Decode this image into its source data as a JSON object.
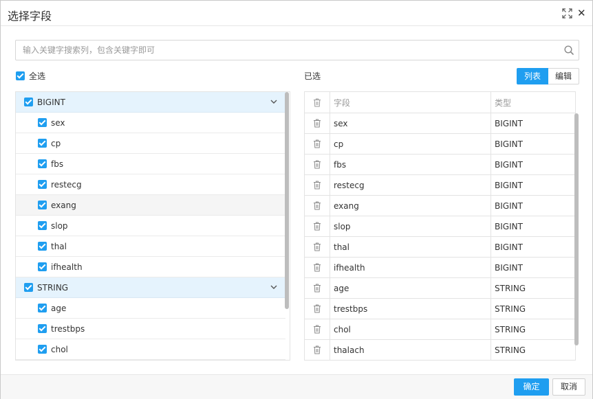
{
  "dialog": {
    "title": "选择字段",
    "maximize_icon": "maximize-icon",
    "close_label": "✕"
  },
  "search": {
    "placeholder": "输入关键字搜索列，包含关键字即可",
    "icon": "search-icon"
  },
  "select_all_label": "全选",
  "selected_label": "已选",
  "view_toggle": {
    "list_label": "列表",
    "edit_label": "编辑"
  },
  "accent_color": "#1f9ef0",
  "groups": [
    {
      "name": "BIGINT",
      "fields": [
        "sex",
        "cp",
        "fbs",
        "restecg",
        "exang",
        "slop",
        "thal",
        "ifhealth"
      ]
    },
    {
      "name": "STRING",
      "fields": [
        "age",
        "trestbps",
        "chol"
      ]
    }
  ],
  "selected_table": {
    "headers": [
      "",
      "字段",
      "类型"
    ],
    "rows": [
      {
        "field": "sex",
        "type": "BIGINT"
      },
      {
        "field": "cp",
        "type": "BIGINT"
      },
      {
        "field": "fbs",
        "type": "BIGINT"
      },
      {
        "field": "restecg",
        "type": "BIGINT"
      },
      {
        "field": "exang",
        "type": "BIGINT"
      },
      {
        "field": "slop",
        "type": "BIGINT"
      },
      {
        "field": "thal",
        "type": "BIGINT"
      },
      {
        "field": "ifhealth",
        "type": "BIGINT"
      },
      {
        "field": "age",
        "type": "STRING"
      },
      {
        "field": "trestbps",
        "type": "STRING"
      },
      {
        "field": "chol",
        "type": "STRING"
      },
      {
        "field": "thalach",
        "type": "STRING"
      }
    ]
  },
  "footer": {
    "ok_label": "确定",
    "cancel_label": "取消"
  }
}
